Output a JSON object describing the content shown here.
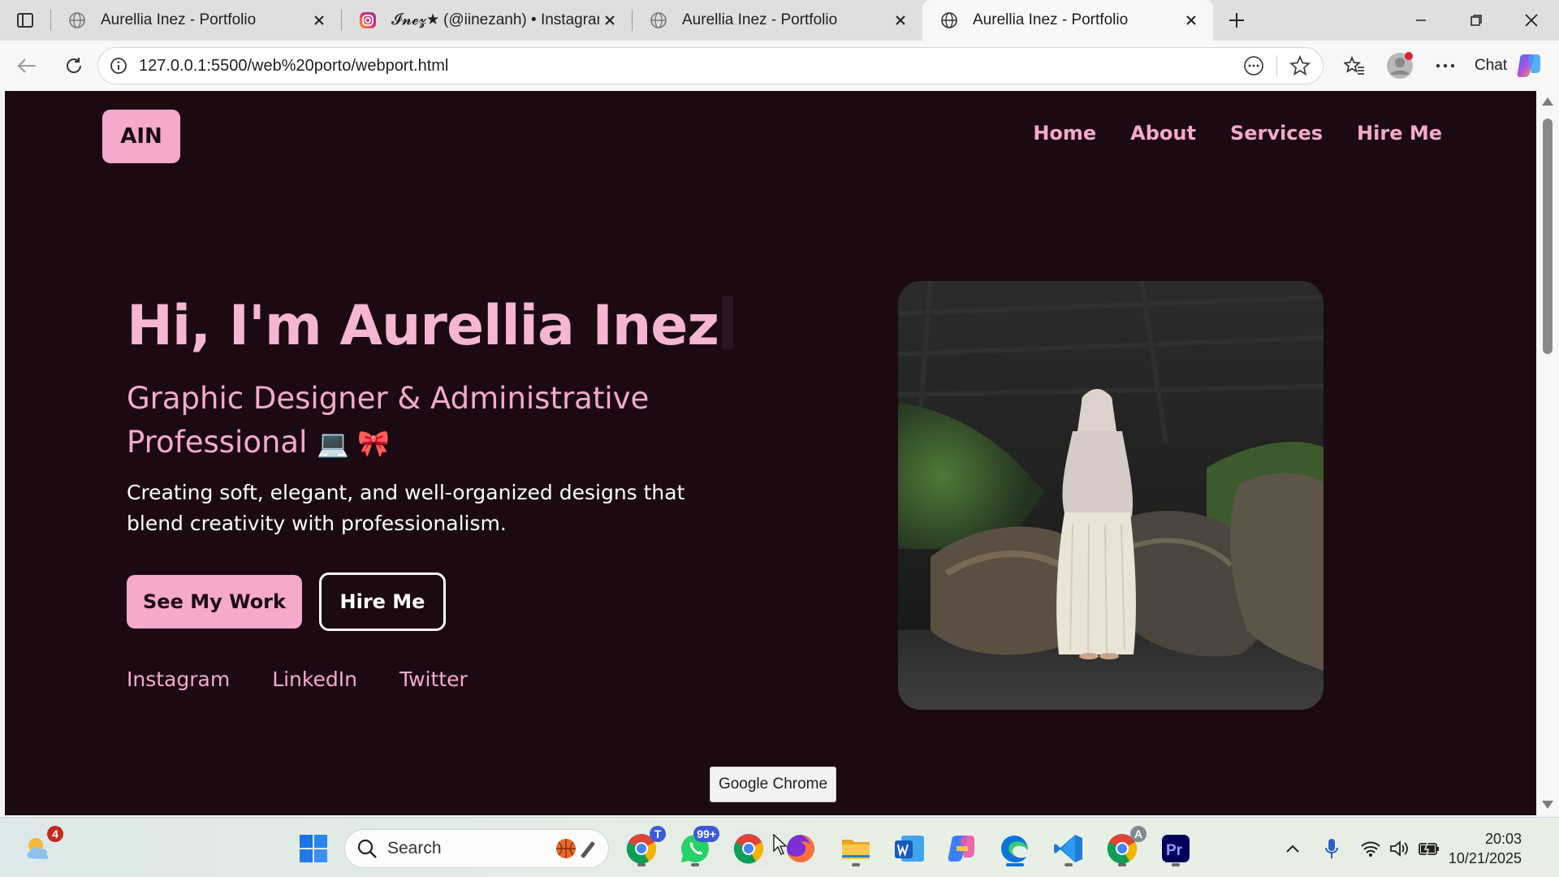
{
  "browser": {
    "tabs": [
      {
        "title": "Aurellia Inez - Portfolio",
        "favicon": "globe-icon",
        "active": false
      },
      {
        "title": "𝓘𝓷𝓮𝔃★ (@iinezanh) • Instagram photos and videos",
        "favicon": "instagram-icon",
        "active": false
      },
      {
        "title": "Aurellia Inez - Portfolio",
        "favicon": "globe-icon",
        "active": false
      },
      {
        "title": "Aurellia Inez - Portfolio",
        "favicon": "globe-icon",
        "active": true
      }
    ],
    "url": "127.0.0.1:5500/web%20porto/webport.html",
    "chat_label": "Chat"
  },
  "page": {
    "logo": "AIN",
    "nav": [
      "Home",
      "About",
      "Services",
      "Hire Me"
    ],
    "hero": {
      "title": "Hi, I'm Aurellia Inez",
      "subtitle": "Graphic Designer & Administrative Professional",
      "subtitle_emoji": "💻 🎀",
      "description": "Creating soft, elegant, and well-organized designs that blend creativity with professionalism.",
      "primary_button": "See My Work",
      "secondary_button": "Hire Me"
    },
    "socials": [
      "Instagram",
      "LinkedIn",
      "Twitter"
    ],
    "photo_alt": "Portrait of woman in white dress standing on rocks by a cliff"
  },
  "tooltip": "Google Chrome",
  "taskbar": {
    "search_placeholder": "Search",
    "weather_badge": "4",
    "chrome_profile_badge": "T",
    "whatsapp_badge": "99+",
    "chrome2_badge": "A",
    "time": "20:03",
    "date": "10/21/2025"
  },
  "colors": {
    "page_bg": "#1b0a12",
    "accent_pink": "#f6a9cc"
  }
}
